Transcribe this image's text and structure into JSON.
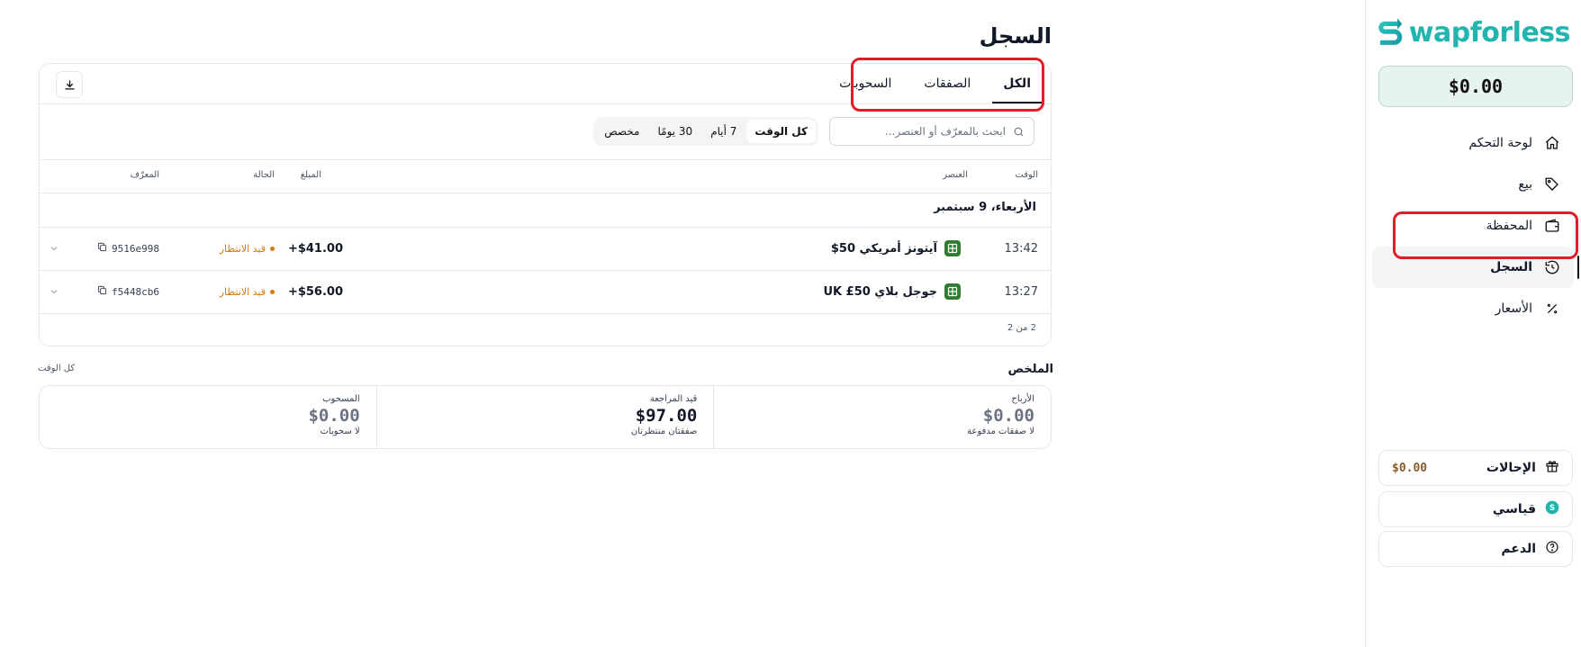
{
  "brand": {
    "name": "wapforless",
    "logo_letter": "S"
  },
  "sidebar": {
    "balance": "$0.00",
    "nav": [
      {
        "label": "لوحة التحكم",
        "icon": "home-icon"
      },
      {
        "label": "بيع",
        "icon": "tag-icon"
      },
      {
        "label": "المحفظة",
        "icon": "wallet-icon"
      },
      {
        "label": "السجل",
        "icon": "history-icon",
        "active": true
      },
      {
        "label": "الأسعار",
        "icon": "percent-icon"
      }
    ],
    "referrals": {
      "label": "الإحالات",
      "amount": "$0.00"
    },
    "tier": {
      "label": "قياسي"
    },
    "support": {
      "label": "الدعم"
    }
  },
  "page": {
    "title": "السجل"
  },
  "tabs": [
    "الكل",
    "الصفقات",
    "السحوبات"
  ],
  "search": {
    "placeholder": "ابحث بالمعرّف أو العنصر..."
  },
  "ranges": [
    "كل الوقت",
    "7 أيام",
    "30 يومًا",
    "مخصص"
  ],
  "table": {
    "headers": {
      "time": "الوقت",
      "item": "العنصر",
      "amount": "المبلغ",
      "status": "الحالة",
      "id": "المعرّف"
    },
    "group": "الأربعاء، 9 سبتمبر",
    "rows": [
      {
        "time": "13:42",
        "item": "آيتونز أمريكي 50$",
        "amount": "+$41.00",
        "status": "قيد الانتظار",
        "id": "9516e998"
      },
      {
        "time": "13:27",
        "item": "جوجل بلاي 50£ UK",
        "amount": "+$56.00",
        "status": "قيد الانتظار",
        "id": "f5448cb6"
      }
    ],
    "pagination": "2 من 2"
  },
  "summary": {
    "title": "الملخص",
    "range": "كل الوقت",
    "cols": [
      {
        "label": "الأرباح",
        "value": "$0.00",
        "sub": "لا صفقات مدفوعة"
      },
      {
        "label": "قيد المراجعة",
        "value": "$97.00",
        "sub": "صفقتان منتظرتان"
      },
      {
        "label": "المسحوب",
        "value": "$0.00",
        "sub": "لا سحوبات"
      }
    ]
  },
  "colors": {
    "brand": "#22b5b0",
    "pending": "#d97706",
    "highlight": "#e11d2a",
    "item_icon": "#2f7d32"
  }
}
